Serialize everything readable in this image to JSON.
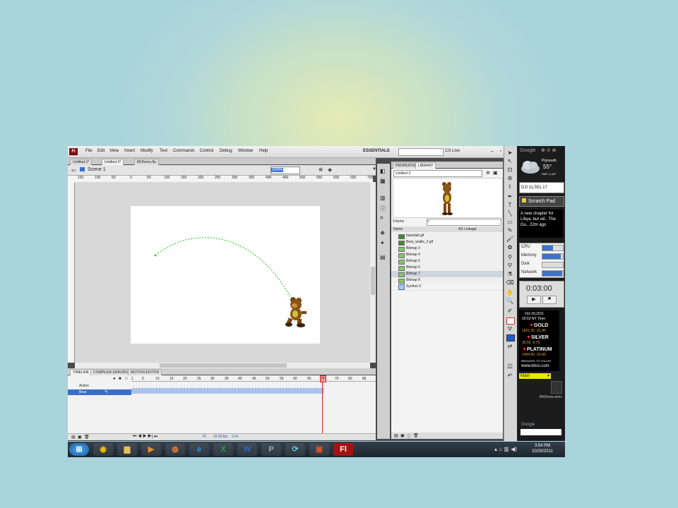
{
  "flash": {
    "menus": [
      "File",
      "Edit",
      "View",
      "Insert",
      "Modify",
      "Text",
      "Commands",
      "Control",
      "Debug",
      "Window",
      "Help"
    ],
    "workspace": "ESSENTIALS",
    "cs_live": "CS Live",
    "doc_tabs": [
      "Untitled-1*",
      "Untitled-2*",
      "BKDemo.fla"
    ],
    "scene": "Scene 1",
    "zoom": "100%",
    "ruler_ticks": [
      "150",
      "100",
      "50",
      "0",
      "50",
      "100",
      "150",
      "200",
      "250",
      "300",
      "350",
      "400",
      "450",
      "500",
      "550",
      "600",
      "650",
      "700"
    ],
    "timeline_tabs": [
      "TIMELINE",
      "COMPILER ERRORS",
      "MOTION EDITOR"
    ],
    "frame_numbers": [
      "1",
      "5",
      "10",
      "15",
      "20",
      "25",
      "30",
      "35",
      "40",
      "45",
      "50",
      "55",
      "60",
      "65",
      "70",
      "75",
      "80",
      "85"
    ],
    "layers": [
      {
        "name": "Action"
      },
      {
        "name": "Bear"
      }
    ],
    "status": {
      "frame": "70",
      "fps": "20.00 fps",
      "time": "3.4s"
    }
  },
  "library": {
    "tabs": [
      "PROPERTIES",
      "LIBRARY"
    ],
    "document": "Untitled-2",
    "count": "9 items",
    "col_name": "Name",
    "col_linkage": "AS Linkage",
    "items": [
      {
        "name": "baseball.gif",
        "kind": "gif"
      },
      {
        "name": "Bear_walks_2.gif",
        "kind": "gif"
      },
      {
        "name": "Bitmap 3",
        "kind": "bmp"
      },
      {
        "name": "Bitmap 4",
        "kind": "bmp"
      },
      {
        "name": "Bitmap 5",
        "kind": "bmp"
      },
      {
        "name": "Bitmap 6",
        "kind": "bmp"
      },
      {
        "name": "Bitmap 7",
        "kind": "bmp"
      },
      {
        "name": "Bitmap 8",
        "kind": "bmp"
      },
      {
        "name": "Symbol 3",
        "kind": "sym"
      }
    ]
  },
  "gadgets": {
    "google": "Google",
    "weather_city": "Plymouth",
    "weather_temp": "55°",
    "weather_range": "H63° | L45°",
    "dji": "DJI 11,551.17",
    "scratch_pad": "Scratch Pad",
    "news": "A new chapter for Libya, but wil.. The Gu.. 22m ago",
    "cpu_labels": [
      "CPU",
      "Memory",
      "Disk",
      "Network"
    ],
    "cpu_levels": [
      0.5,
      0.9,
      0.0,
      0.95
    ],
    "stopwatch": "0:03:00",
    "kitco_date": "Oct 20,2011",
    "kitco_time": "15:53 NY Time",
    "gold": "GOLD",
    "gold_vals": "1621.30 -21.40",
    "silver": "SILVER",
    "silver_vals": "30.50 -0.75",
    "platinum": "PLATINUM",
    "platinum_vals": "1494.00 -10.00",
    "brought": "BROUGHT TO YOU BY",
    "kitco_url": "www.kitco.com",
    "main_sel": "Main",
    "desktop_file": "BKDemo.wmv"
  },
  "taskbar": {
    "time": "3:54 PM",
    "date": "10/20/2011",
    "fl": "Fl"
  },
  "colors": {
    "accent": "#3f72c9",
    "stage_path": "#44c93a",
    "playhead": "#e02020"
  }
}
